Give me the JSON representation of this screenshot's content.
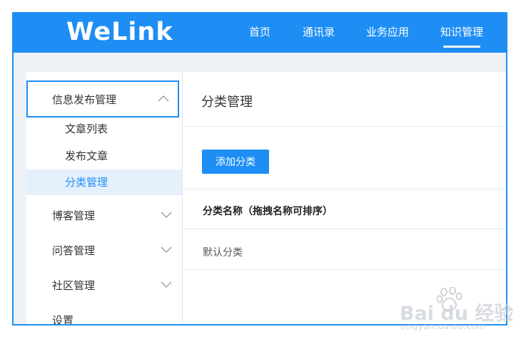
{
  "header": {
    "logo_text": "WeLink",
    "nav": [
      {
        "label": "首页",
        "active": false
      },
      {
        "label": "通讯录",
        "active": false
      },
      {
        "label": "业务应用",
        "active": false
      },
      {
        "label": "知识管理",
        "active": true
      }
    ]
  },
  "sidebar": {
    "groups": [
      {
        "label": "信息发布管理",
        "expanded": true,
        "items": [
          {
            "label": "文章列表",
            "selected": false
          },
          {
            "label": "发布文章",
            "selected": false
          },
          {
            "label": "分类管理",
            "selected": true
          }
        ]
      },
      {
        "label": "博客管理",
        "expanded": false
      },
      {
        "label": "问答管理",
        "expanded": false
      },
      {
        "label": "社区管理",
        "expanded": false
      },
      {
        "label": "设置",
        "expanded": false
      }
    ]
  },
  "main": {
    "title": "分类管理",
    "add_button_label": "添加分类",
    "table": {
      "header": "分类名称（拖拽名称可排序）",
      "rows": [
        {
          "name": "默认分类"
        }
      ]
    }
  },
  "watermark": {
    "text": "Bai du 经验",
    "sub": "jingyan.baidu.com"
  },
  "colors": {
    "accent": "#1e8ef5",
    "selected_bg": "#e4f0fc",
    "page_bg": "#eef1f5"
  },
  "icons": {
    "expanded_chevron": "chevron-up-icon",
    "collapsed_chevron": "chevron-down-icon"
  }
}
